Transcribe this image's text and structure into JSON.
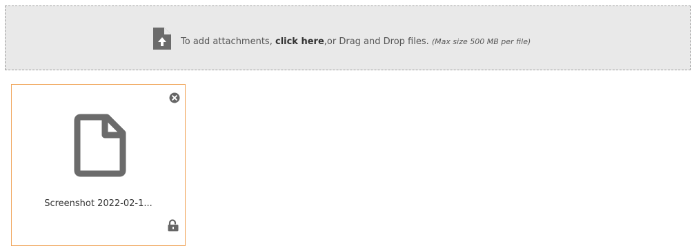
{
  "dropzone": {
    "text_before": "To add attachments, ",
    "link_label": "click here",
    "text_after": ",or Drag and Drop files. ",
    "size_note": "(Max size 500 MB per file)",
    "icon": "file-upload-icon"
  },
  "attachments": [
    {
      "file_name": "Screenshot 2022-02-1...",
      "icon": "document-icon",
      "remove_icon": "close-circle-icon",
      "lock_icon": "unlock-icon"
    }
  ],
  "colors": {
    "dropzone_bg": "#e9e9e9",
    "dropzone_border": "#9a9a9a",
    "card_border": "#f0a55a",
    "icon_gray": "#6b6b6b"
  }
}
